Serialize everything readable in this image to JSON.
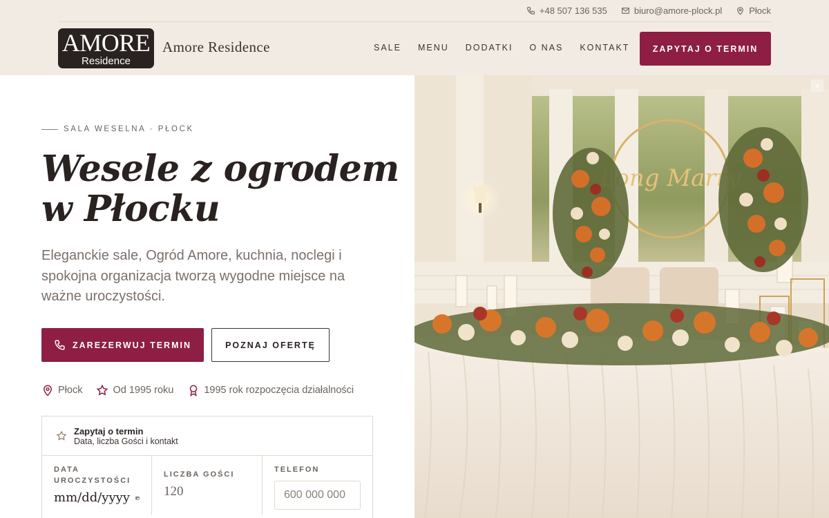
{
  "topbar": {
    "phone": "+48 507 136 535",
    "email": "biuro@amore-plock.pl",
    "location": "Płock"
  },
  "brand": {
    "logo_big": "AMORE",
    "logo_small": "Residence",
    "name": "Amore Residence"
  },
  "nav": {
    "items": [
      "SALE",
      "MENU",
      "DODATKI",
      "O NAS",
      "KONTAKT"
    ],
    "cta": "ZAPYTAJ O TERMIN"
  },
  "hero": {
    "eyebrow": "SALA WESELNA · PŁOCK",
    "title_line1": "Wesele z ogrodem",
    "title_line2": "w Płocku",
    "lead": "Eleganckie sale, Ogród Amore, kuchnia, noclegi i spokojna organizacja tworzą wygodne miejsce na ważne uroczystości.",
    "btn_primary": "ZAREZERWUJ TERMIN",
    "btn_secondary": "POZNAJ OFERTĘ"
  },
  "facts": [
    {
      "icon": "map-pin-icon",
      "text": "Płock"
    },
    {
      "icon": "star-icon",
      "text": "Od 1995 roku"
    },
    {
      "icon": "award-icon",
      "text": "1995 rok rozpoczęcia działalności"
    }
  ],
  "form": {
    "head_title": "Zapytaj o termin",
    "head_sub": "Data, liczba Gości i kontakt",
    "date_label": "DATA UROCZYSTOŚCI",
    "date_value": "mm/dd/yyyy",
    "guests_label": "LICZBA GOŚCI",
    "guests_value": "120",
    "phone_label": "TELEFON",
    "phone_placeholder": "600 000 000"
  },
  "image": {
    "sign_text": "Long Marry",
    "close": "×"
  },
  "colors": {
    "accent": "#8e1e44",
    "header_bg": "#f1ebe3",
    "dark": "#2a2220"
  }
}
